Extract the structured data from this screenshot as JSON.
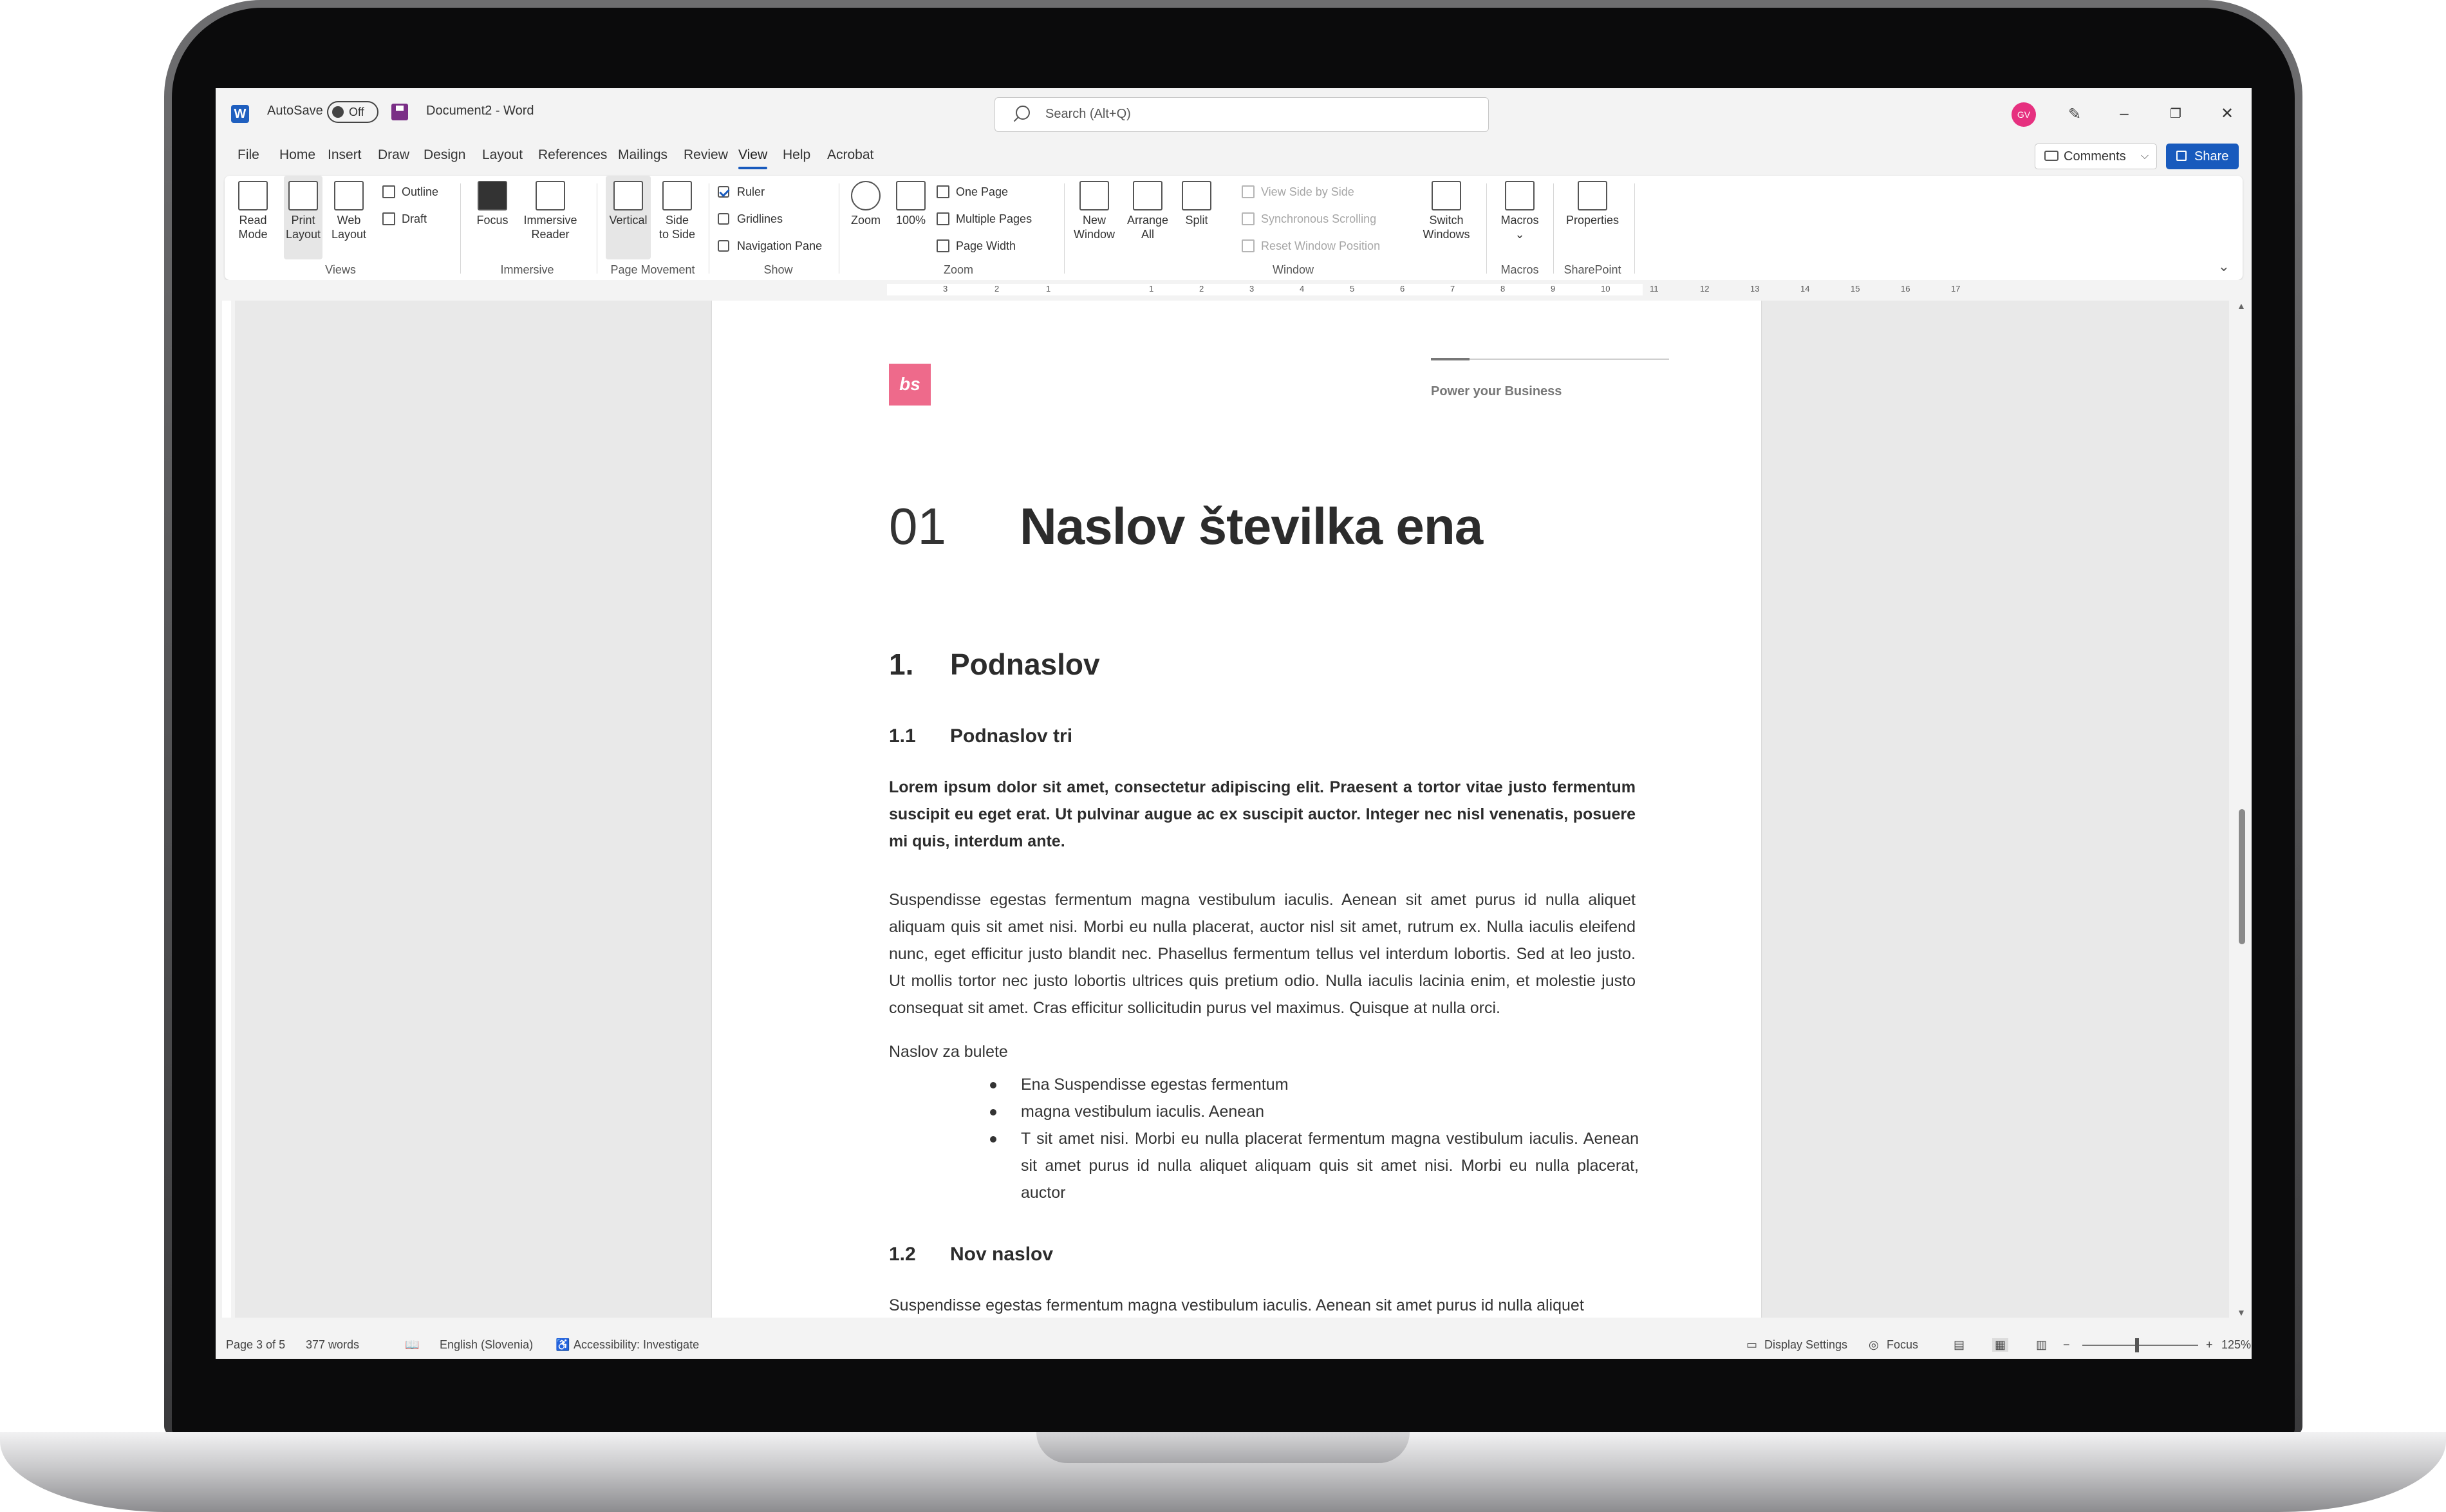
{
  "titlebar": {
    "autosave_label": "AutoSave",
    "autosave_state": "Off",
    "document_name": "Document2  -  Word",
    "search_placeholder": "Search (Alt+Q)",
    "avatar_initials": "GV"
  },
  "menu": {
    "tabs": [
      "File",
      "Home",
      "Insert",
      "Draw",
      "Design",
      "Layout",
      "References",
      "Mailings",
      "Review",
      "View",
      "Help",
      "Acrobat"
    ],
    "active": "View",
    "comments_label": "Comments",
    "share_label": "Share"
  },
  "ribbon": {
    "views": {
      "read_mode": [
        "Read",
        "Mode"
      ],
      "print_layout": [
        "Print",
        "Layout"
      ],
      "web_layout": [
        "Web",
        "Layout"
      ],
      "outline": "Outline",
      "draft": "Draft",
      "group": "Views"
    },
    "immersive": {
      "focus": "Focus",
      "immersive_reader": [
        "Immersive",
        "Reader"
      ],
      "group": "Immersive"
    },
    "page_movement": {
      "vertical": "Vertical",
      "side_to_side": [
        "Side",
        "to Side"
      ],
      "group": "Page Movement"
    },
    "show": {
      "ruler": "Ruler",
      "gridlines": "Gridlines",
      "navigation_pane": "Navigation Pane",
      "group": "Show",
      "ruler_checked": true
    },
    "zoom": {
      "zoom": "Zoom",
      "hundred": "100%",
      "one_page": "One Page",
      "multiple_pages": "Multiple Pages",
      "page_width": "Page Width",
      "group": "Zoom"
    },
    "window": {
      "new_window": [
        "New",
        "Window"
      ],
      "arrange_all": [
        "Arrange",
        "All"
      ],
      "split": "Split",
      "view_side_by_side": "View Side by Side",
      "synchronous_scrolling": "Synchronous Scrolling",
      "reset_window_position": "Reset Window Position",
      "switch_windows": [
        "Switch",
        "Windows"
      ],
      "group": "Window"
    },
    "macros": {
      "macros": "Macros",
      "group": "Macros"
    },
    "sharepoint": {
      "properties": "Properties",
      "group": "SharePoint"
    }
  },
  "ruler_numbers": [
    "3",
    "2",
    "1",
    "1",
    "2",
    "3",
    "4",
    "5",
    "6",
    "7",
    "8",
    "9",
    "10",
    "11",
    "12",
    "13",
    "14",
    "15",
    "16",
    "17"
  ],
  "document": {
    "tagline": "Power your Business",
    "logo_text": "bs",
    "h1_number": "01",
    "h1_title": "Naslov številka ena",
    "h2_number": "1.",
    "h2_title": "Podnaslov",
    "h3a_number": "1.1",
    "h3a_title": "Podnaslov tri",
    "bold_paragraph": "Lorem ipsum dolor sit amet, consectetur adipiscing elit. Praesent a tortor vitae justo fermentum suscipit eu eget erat. Ut pulvinar augue ac ex suscipit auctor. Integer nec nisl venenatis, posuere mi quis, interdum ante.",
    "paragraph1": "Suspendisse egestas fermentum magna vestibulum iaculis. Aenean sit amet purus id nulla aliquet aliquam quis sit amet nisi. Morbi eu nulla placerat, auctor nisl sit amet, rutrum ex. Nulla iaculis eleifend nunc, eget efficitur justo blandit nec. Phasellus fermentum tellus vel interdum lobortis. Sed at leo justo. Ut mollis tortor nec justo lobortis ultrices quis pretium odio. Nulla iaculis lacinia enim, et molestie justo consequat sit amet. Cras efficitur sollicitudin purus vel maximus. Quisque at nulla orci.",
    "bullet_heading": "Naslov za bulete",
    "bullets": [
      "Ena Suspendisse egestas fermentum",
      "magna vestibulum iaculis. Aenean",
      "T sit amet nisi. Morbi eu nulla placerat fermentum magna vestibulum iaculis. Aenean sit amet purus id nulla aliquet aliquam quis sit amet nisi. Morbi eu nulla placerat, auctor"
    ],
    "h3b_number": "1.2",
    "h3b_title": "Nov naslov",
    "paragraph2": "Suspendisse egestas fermentum magna vestibulum iaculis. Aenean sit amet purus id nulla aliquet"
  },
  "statusbar": {
    "page": "Page 3 of 5",
    "words": "377 words",
    "language": "English (Slovenia)",
    "accessibility": "Accessibility: Investigate",
    "display_settings": "Display Settings",
    "focus": "Focus",
    "zoom_level": "125%",
    "zoom_minus": "−",
    "zoom_plus": "+"
  },
  "colors": {
    "accent": "#185abd",
    "logo": "#ee6a8b",
    "avatar": "#e6307f"
  }
}
